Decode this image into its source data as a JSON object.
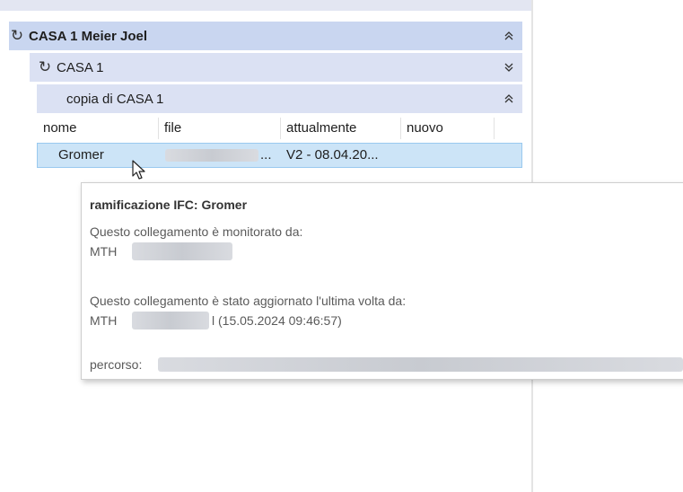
{
  "tree": {
    "root": {
      "label": "CASA 1 Meier  Joel",
      "icon": "refresh-icon",
      "chevron": "collapse-icon"
    },
    "child": {
      "label": "CASA 1",
      "icon": "refresh-icon",
      "chevron": "expand-icon"
    },
    "grandchild": {
      "label": "copia di CASA 1",
      "chevron": "collapse-icon"
    }
  },
  "table": {
    "columns": [
      "nome",
      "file",
      "attualmente",
      "nuovo"
    ],
    "rows": [
      {
        "nome": "Gromer",
        "file": "...",
        "attualmente": "V2 - 08.04.20...",
        "nuovo": ""
      }
    ]
  },
  "tooltip": {
    "title": "ramificazione IFC: Gromer",
    "monitored_label": "Questo collegamento è monitorato da:",
    "monitored_by": "MTH",
    "updated_label": "Questo collegamento è stato aggiornato l'ultima volta da:",
    "updated_by": "MTH",
    "updated_suffix": "l (15.05.2024 09:46:57)",
    "path_label": "percorso:"
  },
  "chevrons": {
    "collapse": "≈",
    "expand": "≈"
  }
}
